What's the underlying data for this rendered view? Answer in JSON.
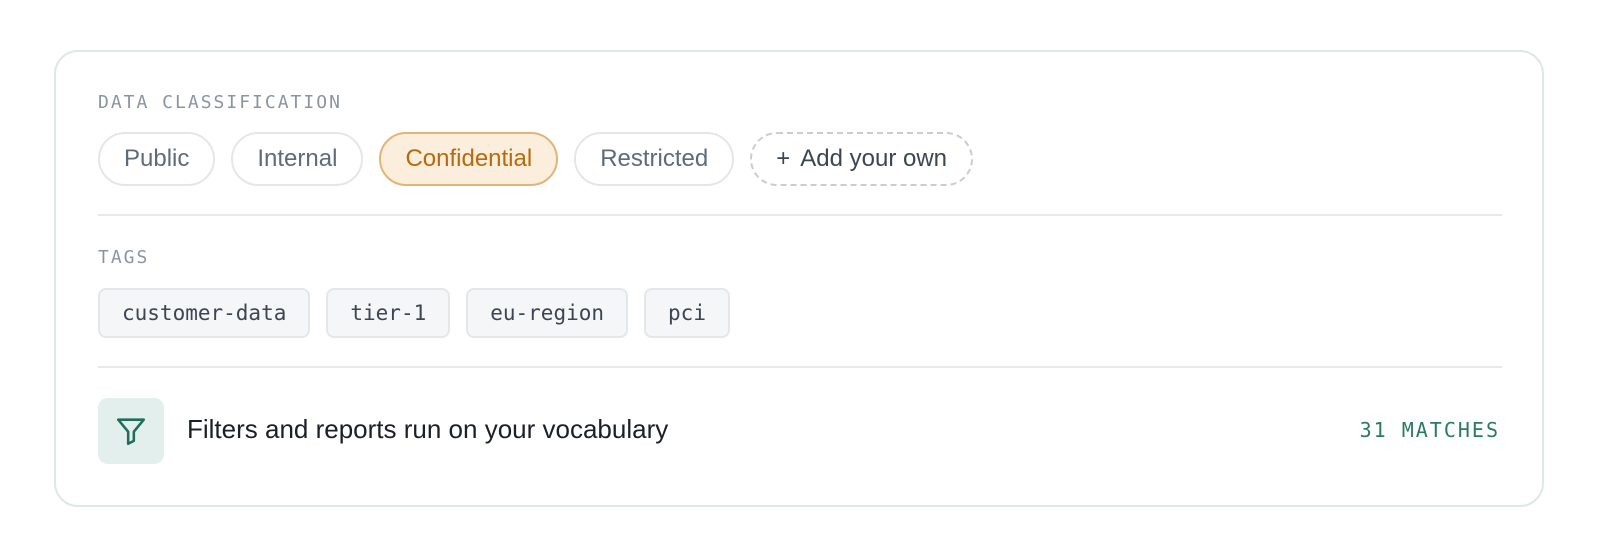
{
  "classification": {
    "label": "DATA CLASSIFICATION",
    "options": [
      {
        "label": "Public",
        "selected": false
      },
      {
        "label": "Internal",
        "selected": false
      },
      {
        "label": "Confidential",
        "selected": true
      },
      {
        "label": "Restricted",
        "selected": false
      }
    ],
    "add_label": "Add your own",
    "add_icon": "plus-icon"
  },
  "tags": {
    "label": "TAGS",
    "items": [
      "customer-data",
      "tier-1",
      "eu-region",
      "pci"
    ]
  },
  "footer": {
    "icon": "filter-icon",
    "text": "Filters and reports run on your vocabulary",
    "matches": "31 MATCHES"
  },
  "colors": {
    "accent": "#2a7a64",
    "selected_bg": "#fbeedd",
    "selected_text": "#b86a0c"
  }
}
